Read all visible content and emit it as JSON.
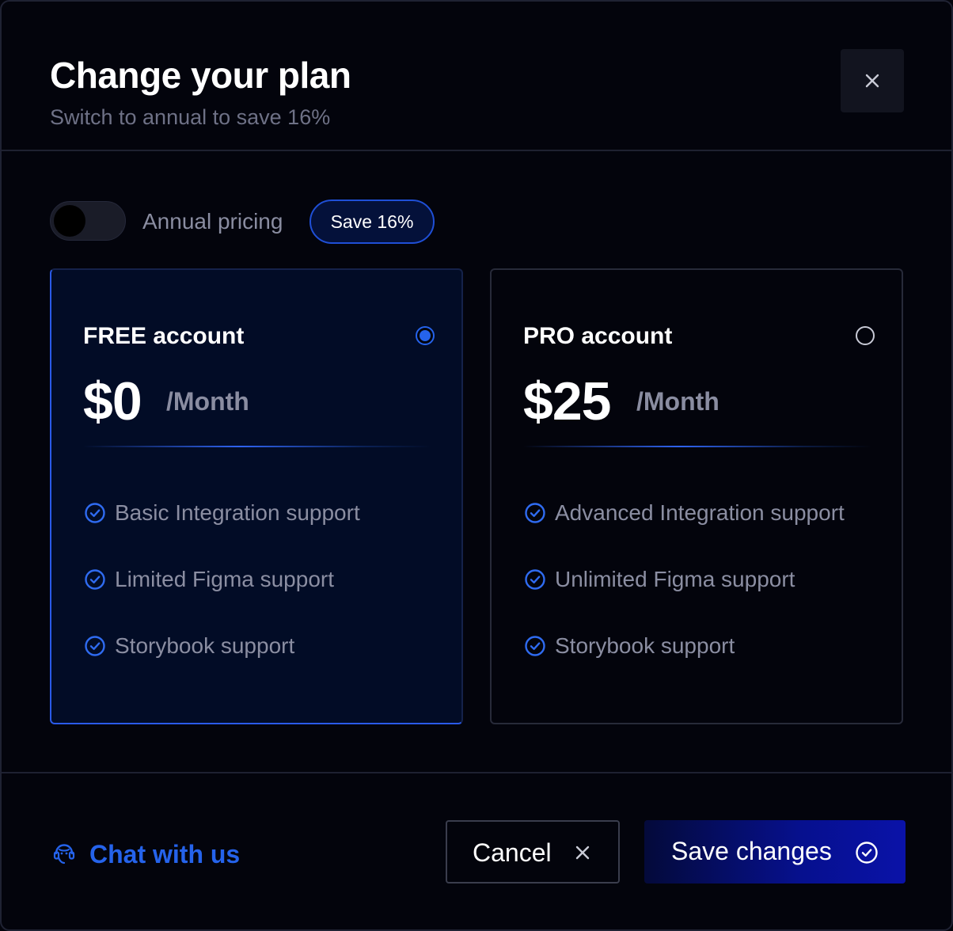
{
  "header": {
    "title": "Change your plan",
    "subtitle": "Switch to annual to save 16%",
    "close_icon": "close-icon"
  },
  "billing": {
    "toggle_state": "off",
    "label": "Annual pricing",
    "badge": "Save 16%"
  },
  "plans": [
    {
      "name": "FREE account",
      "price": "$0",
      "period": "/Month",
      "selected": true,
      "features": [
        "Basic Integration support",
        "Limited Figma support",
        "Storybook support"
      ]
    },
    {
      "name": "PRO account",
      "price": "$25",
      "period": "/Month",
      "selected": false,
      "features": [
        "Advanced Integration support",
        "Unlimited Figma support",
        "Storybook support"
      ]
    }
  ],
  "footer": {
    "chat_label": "Chat with us",
    "chat_icon": "support-agent-icon",
    "cancel_label": "Cancel",
    "save_label": "Save changes"
  },
  "colors": {
    "accent": "#2563eb",
    "background": "#03040c",
    "selected_card_bg": "#020c26",
    "muted_text": "#8b8ea2"
  }
}
